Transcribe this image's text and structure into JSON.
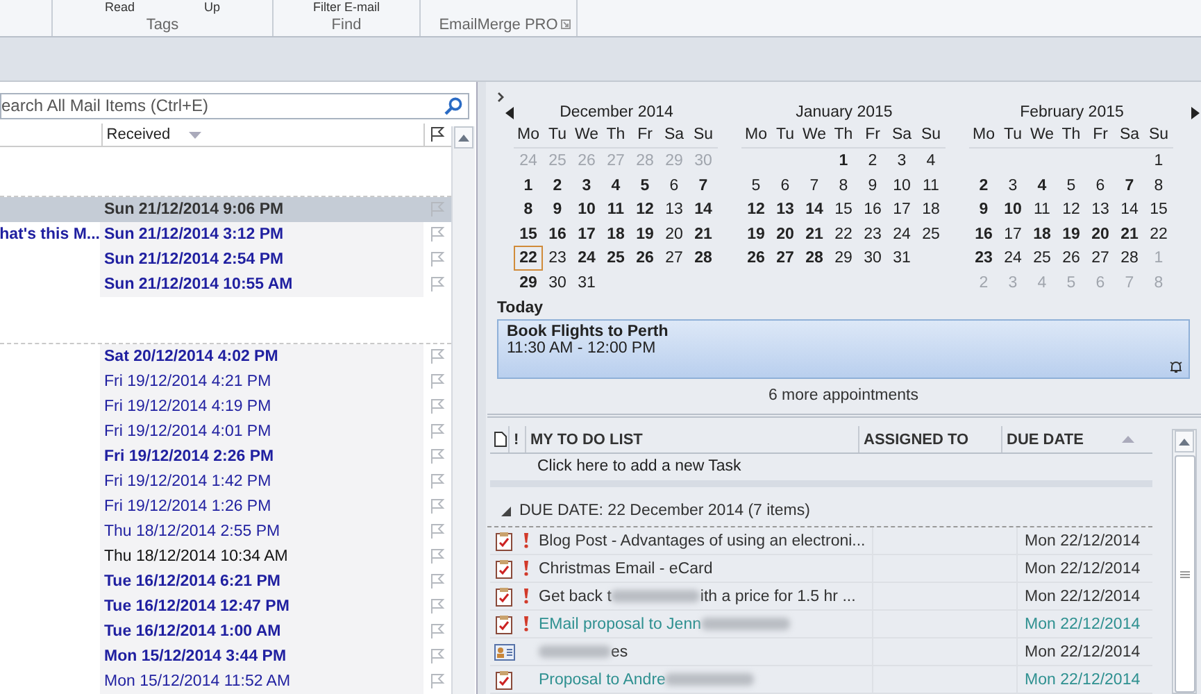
{
  "ribbon": {
    "buttons": [
      {
        "label": "Read"
      },
      {
        "label": "Up"
      },
      {
        "label": "Filter E-mail"
      }
    ],
    "groups": [
      {
        "label": "Tags"
      },
      {
        "label": "Find"
      },
      {
        "label": "EmailMerge PRO",
        "launcher": true
      }
    ]
  },
  "mail": {
    "search": {
      "placeholder": "earch All Mail Items (Ctrl+E)"
    },
    "columns": [
      {
        "label": "Received"
      }
    ],
    "groups": [
      {
        "rows": [
          {
            "received": "Sun 21/12/2014 9:06 PM",
            "bold": true,
            "color": "#333333",
            "selected": true
          },
          {
            "subject": "hat's this M...",
            "received": "Sun 21/12/2014 3:12 PM",
            "bold": true,
            "color": "#1f1fa0",
            "selected": false
          },
          {
            "received": "Sun 21/12/2014 2:54 PM",
            "bold": true,
            "color": "#1f1fa0",
            "selected": false
          },
          {
            "received": "Sun 21/12/2014 10:55 AM",
            "bold": true,
            "color": "#1f1fa0",
            "selected": false
          }
        ]
      },
      {
        "rows": [
          {
            "received": "Sat 20/12/2014 4:02 PM",
            "bold": true,
            "color": "#1f1fa0",
            "selected": false
          },
          {
            "received": "Fri 19/12/2014 4:21 PM",
            "bold": false,
            "color": "#1f1fa0",
            "selected": false
          },
          {
            "received": "Fri 19/12/2014 4:19 PM",
            "bold": false,
            "color": "#1f1fa0",
            "selected": false
          },
          {
            "received": "Fri 19/12/2014 4:01 PM",
            "bold": false,
            "color": "#1f1fa0",
            "selected": false
          },
          {
            "received": "Fri 19/12/2014 2:26 PM",
            "bold": true,
            "color": "#1f1fa0",
            "selected": false
          },
          {
            "received": "Fri 19/12/2014 1:42 PM",
            "bold": false,
            "color": "#1f1fa0",
            "selected": false
          },
          {
            "received": "Fri 19/12/2014 1:26 PM",
            "bold": false,
            "color": "#1f1fa0",
            "selected": false
          },
          {
            "received": "Thu 18/12/2014 2:55 PM",
            "bold": false,
            "color": "#1f1fa0",
            "selected": false
          },
          {
            "received": "Thu 18/12/2014 10:34 AM",
            "bold": false,
            "color": "#111111",
            "selected": false
          },
          {
            "received": "Tue 16/12/2014 6:21 PM",
            "bold": true,
            "color": "#1f1fa0",
            "selected": false
          },
          {
            "received": "Tue 16/12/2014 12:47 PM",
            "bold": true,
            "color": "#1f1fa0",
            "selected": false
          },
          {
            "received": "Tue 16/12/2014 1:00 AM",
            "bold": true,
            "color": "#1f1fa0",
            "selected": false
          },
          {
            "received": "Mon 15/12/2014 3:44 PM",
            "bold": true,
            "color": "#1f1fa0",
            "selected": false
          },
          {
            "received": "Mon 15/12/2014 11:52 AM",
            "bold": false,
            "color": "#1f1fa0",
            "selected": false
          }
        ]
      }
    ]
  },
  "calendar": {
    "months": [
      {
        "title": "December 2014",
        "prev": true,
        "next": false,
        "weekdays": [
          "Mo",
          "Tu",
          "We",
          "Th",
          "Fr",
          "Sa",
          "Su"
        ],
        "weeks": [
          [
            {
              "d": "24",
              "kind": "other"
            },
            {
              "d": "25",
              "kind": "other"
            },
            {
              "d": "26",
              "kind": "other"
            },
            {
              "d": "27",
              "kind": "other"
            },
            {
              "d": "28",
              "kind": "other"
            },
            {
              "d": "29",
              "kind": "other"
            },
            {
              "d": "30",
              "kind": "other"
            }
          ],
          [
            {
              "d": "1",
              "kind": "bold"
            },
            {
              "d": "2",
              "kind": "bold"
            },
            {
              "d": "3",
              "kind": "bold"
            },
            {
              "d": "4",
              "kind": "bold"
            },
            {
              "d": "5",
              "kind": "bold"
            },
            {
              "d": "6",
              "kind": "plain"
            },
            {
              "d": "7",
              "kind": "bold"
            }
          ],
          [
            {
              "d": "8",
              "kind": "bold"
            },
            {
              "d": "9",
              "kind": "bold"
            },
            {
              "d": "10",
              "kind": "bold"
            },
            {
              "d": "11",
              "kind": "bold"
            },
            {
              "d": "12",
              "kind": "bold"
            },
            {
              "d": "13",
              "kind": "plain"
            },
            {
              "d": "14",
              "kind": "bold"
            }
          ],
          [
            {
              "d": "15",
              "kind": "bold"
            },
            {
              "d": "16",
              "kind": "bold"
            },
            {
              "d": "17",
              "kind": "bold"
            },
            {
              "d": "18",
              "kind": "bold"
            },
            {
              "d": "19",
              "kind": "bold"
            },
            {
              "d": "20",
              "kind": "plain"
            },
            {
              "d": "21",
              "kind": "bold"
            }
          ],
          [
            {
              "d": "22",
              "kind": "today"
            },
            {
              "d": "23",
              "kind": "plain"
            },
            {
              "d": "24",
              "kind": "bold"
            },
            {
              "d": "25",
              "kind": "bold"
            },
            {
              "d": "26",
              "kind": "bold"
            },
            {
              "d": "27",
              "kind": "plain"
            },
            {
              "d": "28",
              "kind": "bold"
            }
          ],
          [
            {
              "d": "29",
              "kind": "bold"
            },
            {
              "d": "30",
              "kind": "plain"
            },
            {
              "d": "31",
              "kind": "plain"
            },
            {
              "kind": "blank"
            },
            {
              "kind": "blank"
            },
            {
              "kind": "blank"
            },
            {
              "kind": "blank"
            }
          ]
        ]
      },
      {
        "title": "January 2015",
        "prev": false,
        "next": false,
        "weekdays": [
          "Mo",
          "Tu",
          "We",
          "Th",
          "Fr",
          "Sa",
          "Su"
        ],
        "weeks": [
          [
            {
              "kind": "blank"
            },
            {
              "kind": "blank"
            },
            {
              "kind": "blank"
            },
            {
              "d": "1",
              "kind": "bold"
            },
            {
              "d": "2",
              "kind": "plain"
            },
            {
              "d": "3",
              "kind": "plain"
            },
            {
              "d": "4",
              "kind": "plain"
            }
          ],
          [
            {
              "d": "5",
              "kind": "plain"
            },
            {
              "d": "6",
              "kind": "plain"
            },
            {
              "d": "7",
              "kind": "plain"
            },
            {
              "d": "8",
              "kind": "plain"
            },
            {
              "d": "9",
              "kind": "plain"
            },
            {
              "d": "10",
              "kind": "plain"
            },
            {
              "d": "11",
              "kind": "plain"
            }
          ],
          [
            {
              "d": "12",
              "kind": "bold"
            },
            {
              "d": "13",
              "kind": "bold"
            },
            {
              "d": "14",
              "kind": "bold"
            },
            {
              "d": "15",
              "kind": "plain"
            },
            {
              "d": "16",
              "kind": "plain"
            },
            {
              "d": "17",
              "kind": "plain"
            },
            {
              "d": "18",
              "kind": "plain"
            }
          ],
          [
            {
              "d": "19",
              "kind": "bold"
            },
            {
              "d": "20",
              "kind": "bold"
            },
            {
              "d": "21",
              "kind": "bold"
            },
            {
              "d": "22",
              "kind": "plain"
            },
            {
              "d": "23",
              "kind": "plain"
            },
            {
              "d": "24",
              "kind": "plain"
            },
            {
              "d": "25",
              "kind": "plain"
            }
          ],
          [
            {
              "d": "26",
              "kind": "bold"
            },
            {
              "d": "27",
              "kind": "bold"
            },
            {
              "d": "28",
              "kind": "bold"
            },
            {
              "d": "29",
              "kind": "plain"
            },
            {
              "d": "30",
              "kind": "plain"
            },
            {
              "d": "31",
              "kind": "plain"
            },
            {
              "kind": "blank"
            }
          ]
        ]
      },
      {
        "title": "February 2015",
        "prev": false,
        "next": true,
        "weekdays": [
          "Mo",
          "Tu",
          "We",
          "Th",
          "Fr",
          "Sa",
          "Su"
        ],
        "weeks": [
          [
            {
              "kind": "blank"
            },
            {
              "kind": "blank"
            },
            {
              "kind": "blank"
            },
            {
              "kind": "blank"
            },
            {
              "kind": "blank"
            },
            {
              "kind": "blank"
            },
            {
              "d": "1",
              "kind": "plain"
            }
          ],
          [
            {
              "d": "2",
              "kind": "bold"
            },
            {
              "d": "3",
              "kind": "plain"
            },
            {
              "d": "4",
              "kind": "bold"
            },
            {
              "d": "5",
              "kind": "plain"
            },
            {
              "d": "6",
              "kind": "plain"
            },
            {
              "d": "7",
              "kind": "bold"
            },
            {
              "d": "8",
              "kind": "plain"
            }
          ],
          [
            {
              "d": "9",
              "kind": "bold"
            },
            {
              "d": "10",
              "kind": "bold"
            },
            {
              "d": "11",
              "kind": "plain"
            },
            {
              "d": "12",
              "kind": "plain"
            },
            {
              "d": "13",
              "kind": "plain"
            },
            {
              "d": "14",
              "kind": "plain"
            },
            {
              "d": "15",
              "kind": "plain"
            }
          ],
          [
            {
              "d": "16",
              "kind": "bold"
            },
            {
              "d": "17",
              "kind": "plain"
            },
            {
              "d": "18",
              "kind": "bold"
            },
            {
              "d": "19",
              "kind": "bold"
            },
            {
              "d": "20",
              "kind": "bold"
            },
            {
              "d": "21",
              "kind": "bold"
            },
            {
              "d": "22",
              "kind": "plain"
            }
          ],
          [
            {
              "d": "23",
              "kind": "bold"
            },
            {
              "d": "24",
              "kind": "plain"
            },
            {
              "d": "25",
              "kind": "plain"
            },
            {
              "d": "26",
              "kind": "plain"
            },
            {
              "d": "27",
              "kind": "plain"
            },
            {
              "d": "28",
              "kind": "plain"
            },
            {
              "d": "1",
              "kind": "other"
            }
          ],
          [
            {
              "d": "2",
              "kind": "other"
            },
            {
              "d": "3",
              "kind": "other"
            },
            {
              "d": "4",
              "kind": "other"
            },
            {
              "d": "5",
              "kind": "other"
            },
            {
              "d": "6",
              "kind": "other"
            },
            {
              "d": "7",
              "kind": "other"
            },
            {
              "d": "8",
              "kind": "other"
            }
          ]
        ]
      }
    ]
  },
  "today": {
    "label": "Today",
    "appointment": {
      "title": "Book Flights to Perth",
      "time": "11:30 AM - 12:00 PM",
      "reminder": true
    },
    "more": "6 more appointments"
  },
  "tasks": {
    "importance_header": "!",
    "columns": [
      {
        "label": "MY TO DO LIST"
      },
      {
        "label": "ASSIGNED TO"
      },
      {
        "label": "DUE DATE"
      }
    ],
    "new_task": "Click here to add a new Task",
    "group": {
      "label": "DUE DATE: 22 December 2014 (7 items)",
      "expanded": true
    },
    "rows": [
      {
        "kind": "task",
        "important": true,
        "color": "#333333",
        "due": "Mon 22/12/2014",
        "subject": [
          {
            "kind": "text",
            "text": "Blog Post - Advantages of using an electroni..."
          }
        ]
      },
      {
        "kind": "task",
        "important": true,
        "color": "#333333",
        "due": "Mon 22/12/2014",
        "subject": [
          {
            "kind": "text",
            "text": "Christmas Email - eCard"
          }
        ]
      },
      {
        "kind": "task",
        "important": true,
        "color": "#333333",
        "due": "Mon 22/12/2014",
        "subject": [
          {
            "kind": "text",
            "text": "Get back t"
          },
          {
            "kind": "blurred"
          },
          {
            "kind": "text",
            "text": "ith a price for 1.5 hr ..."
          }
        ]
      },
      {
        "kind": "task",
        "important": true,
        "color": "#2e9090",
        "due": "Mon 22/12/2014",
        "subject": [
          {
            "kind": "text",
            "text": "EMail proposal to Jenn"
          },
          {
            "kind": "blurred"
          }
        ]
      },
      {
        "kind": "contact",
        "important": false,
        "color": "#333333",
        "due": "Mon 22/12/2014",
        "subject": [
          {
            "kind": "blurred"
          },
          {
            "kind": "text",
            "text": "es"
          }
        ]
      },
      {
        "kind": "task",
        "important": false,
        "color": "#2e9090",
        "due": "Mon 22/12/2014",
        "subject": [
          {
            "kind": "text",
            "text": "Proposal to Andre"
          },
          {
            "kind": "blurred"
          }
        ]
      }
    ]
  }
}
